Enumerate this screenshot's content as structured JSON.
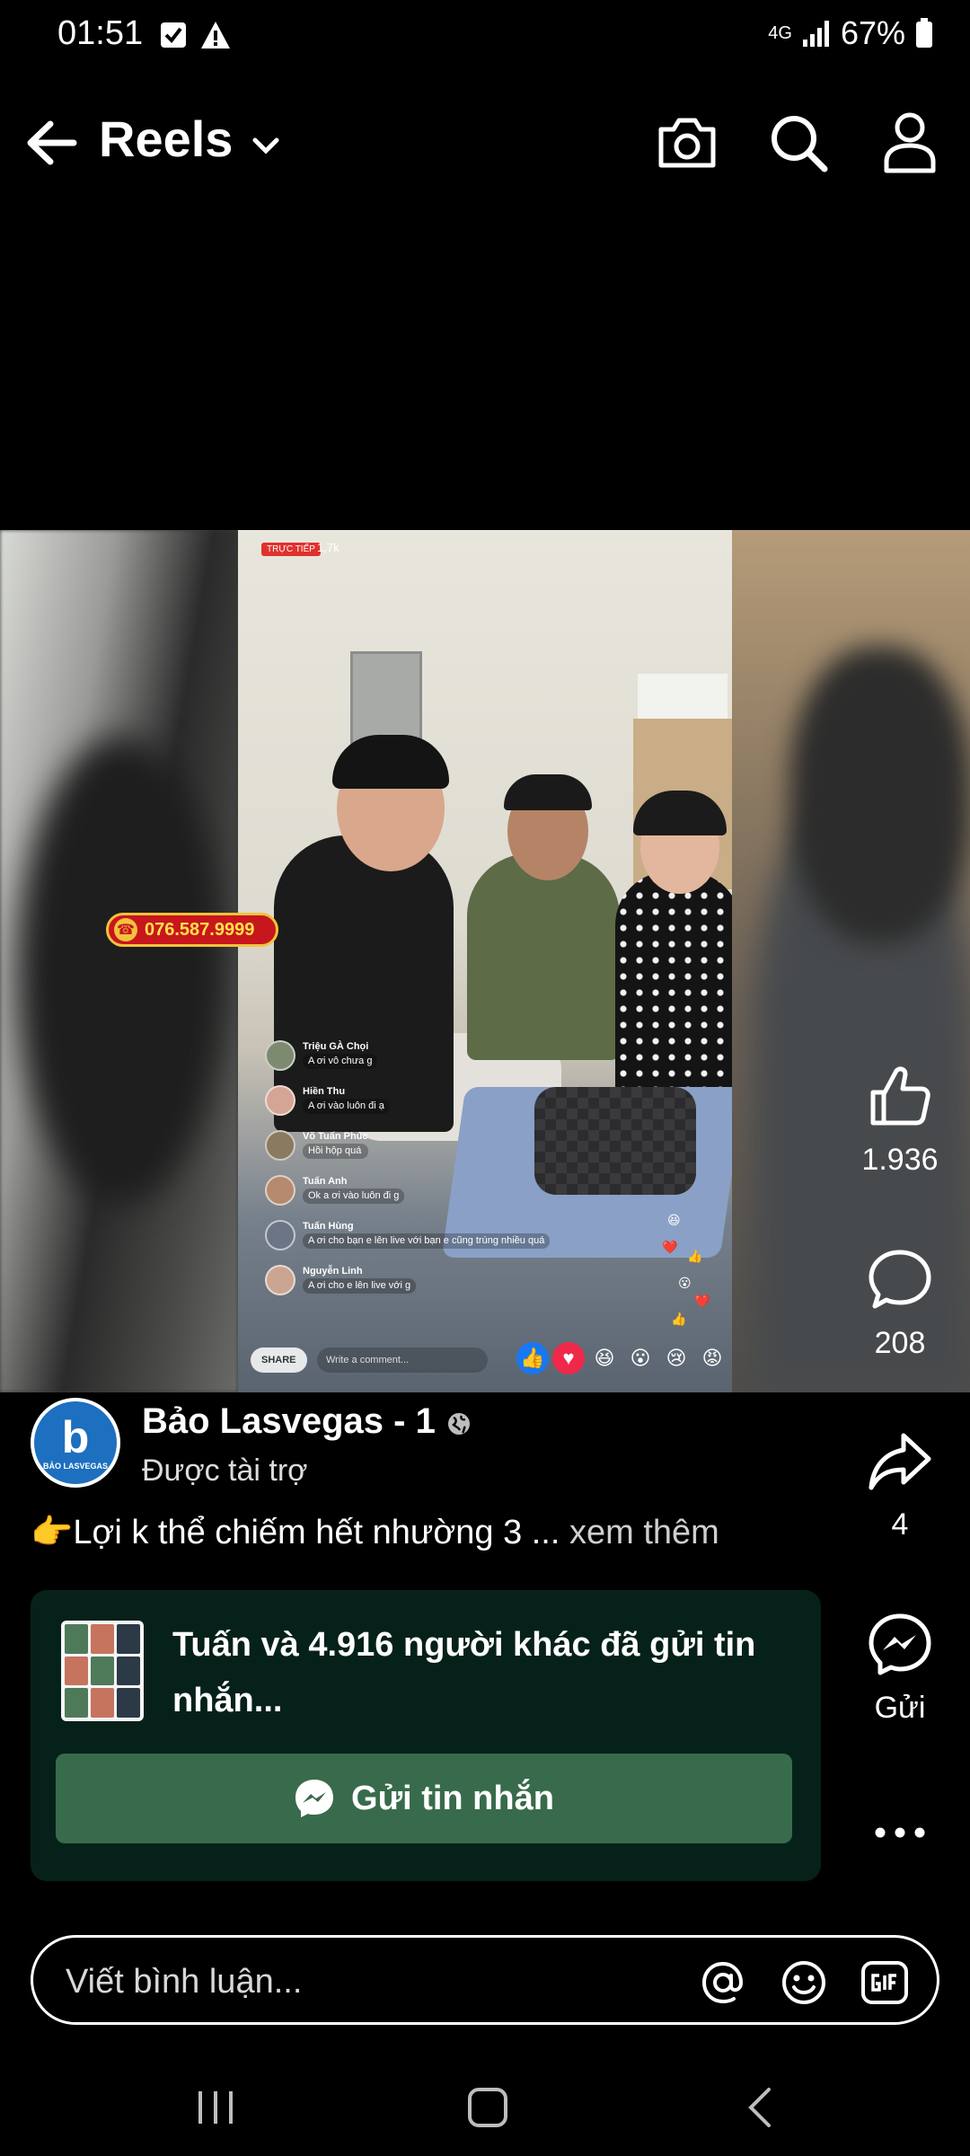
{
  "status_bar": {
    "time": "01:51",
    "network": "4G",
    "battery": "67%"
  },
  "header": {
    "title": "Reels"
  },
  "video": {
    "live_badge": "TRỰC TIẾP",
    "live_views": "1,7k",
    "phone_number": "076.587.9999",
    "comments": [
      {
        "name": "Triệu GÀ Chọi",
        "text": "A ơi vô chưa g"
      },
      {
        "name": "Hiền Thu",
        "text": "A ơi vào luôn đi ạ"
      },
      {
        "name": "Võ Tuấn Phúc",
        "text": "Hồi hộp quá"
      },
      {
        "name": "Tuấn Anh",
        "text": "Ok a ơi vào luôn đi g"
      },
      {
        "name": "Tuấn Hùng",
        "text": "A ơi cho bạn e lên live với bạn e cũng trúng nhiều quá"
      },
      {
        "name": "Nguyễn Linh",
        "text": "A ơi cho e lên live với g"
      }
    ],
    "share_label": "SHARE",
    "write_comment": "Write a comment..."
  },
  "actions": {
    "likes": "1.936",
    "comments": "208",
    "shares": "4",
    "send_label": "Gửi"
  },
  "post": {
    "author": "Bảo Lasvegas - 1",
    "avatar_text": "BẢO LASVEGAS",
    "sponsored": "Được tài trợ",
    "caption": "👉Lợi k thể chiếm hết nhường 3 ...",
    "see_more": "xem thêm"
  },
  "message_card": {
    "text": "Tuấn và 4.916 người khác đã gửi tin nhắn...",
    "button_label": "Gửi tin nhắn"
  },
  "comment_bar": {
    "placeholder": "Viết bình luận..."
  },
  "colors": {
    "background": "#000000",
    "card_bg": "#06211a",
    "button_green": "#386b4b",
    "live_red": "#e0312e"
  }
}
